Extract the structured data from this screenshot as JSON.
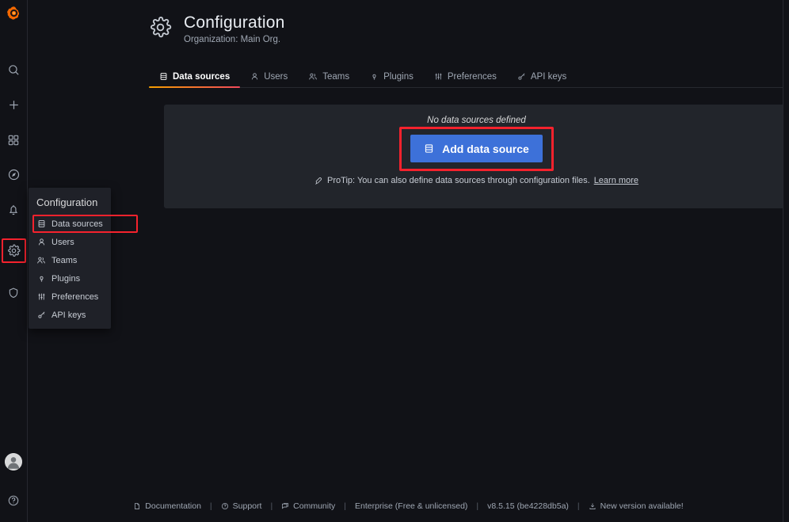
{
  "app": {
    "logo": "grafana-logo",
    "background": "#111217",
    "accent_blue": "#3d71d9",
    "highlight_red": "#f5222d"
  },
  "navrail": {
    "items": [
      {
        "name": "search-icon",
        "label": "Search"
      },
      {
        "name": "plus-icon",
        "label": "Create"
      },
      {
        "name": "dashboards-icon",
        "label": "Dashboards"
      },
      {
        "name": "explore-icon",
        "label": "Explore"
      },
      {
        "name": "alerting-icon",
        "label": "Alerting"
      },
      {
        "name": "gear-icon",
        "label": "Configuration"
      },
      {
        "name": "shield-icon",
        "label": "Server Admin"
      }
    ],
    "bottom": [
      {
        "name": "avatar",
        "label": "User profile"
      },
      {
        "name": "help-icon",
        "label": "Help"
      }
    ]
  },
  "config_menu": {
    "title": "Configuration",
    "items": [
      {
        "label": "Data sources",
        "icon": "database-icon",
        "selected": true
      },
      {
        "label": "Users",
        "icon": "user-icon",
        "selected": false
      },
      {
        "label": "Teams",
        "icon": "users-icon",
        "selected": false
      },
      {
        "label": "Plugins",
        "icon": "plugin-icon",
        "selected": false
      },
      {
        "label": "Preferences",
        "icon": "sliders-icon",
        "selected": false
      },
      {
        "label": "API keys",
        "icon": "key-icon",
        "selected": false
      }
    ]
  },
  "header": {
    "icon": "gear-icon",
    "title": "Configuration",
    "subtitle": "Organization: Main Org."
  },
  "tabs": [
    {
      "label": "Data sources",
      "icon": "database-icon",
      "active": true
    },
    {
      "label": "Users",
      "icon": "user-icon",
      "active": false
    },
    {
      "label": "Teams",
      "icon": "users-icon",
      "active": false
    },
    {
      "label": "Plugins",
      "icon": "plugin-icon",
      "active": false
    },
    {
      "label": "Preferences",
      "icon": "sliders-icon",
      "active": false
    },
    {
      "label": "API keys",
      "icon": "key-icon",
      "active": false
    }
  ],
  "datasources_panel": {
    "empty_message": "No data sources defined",
    "add_button_label": "Add data source",
    "add_button_icon": "database-icon",
    "protip_icon": "rocket-icon",
    "protip_text": "ProTip: You can also define data sources through configuration files.",
    "protip_link": "Learn more"
  },
  "footer": {
    "items": [
      {
        "label": "Documentation",
        "icon": "document-icon",
        "link": true
      },
      {
        "label": "Support",
        "icon": "question-circle-icon",
        "link": true
      },
      {
        "label": "Community",
        "icon": "comment-icon",
        "link": true
      },
      {
        "label": "Enterprise (Free & unlicensed)",
        "icon": "",
        "link": false
      },
      {
        "label": "v8.5.15 (be4228db5a)",
        "icon": "",
        "link": false
      },
      {
        "label": "New version available!",
        "icon": "download-icon",
        "link": true
      }
    ],
    "separator": "|"
  }
}
